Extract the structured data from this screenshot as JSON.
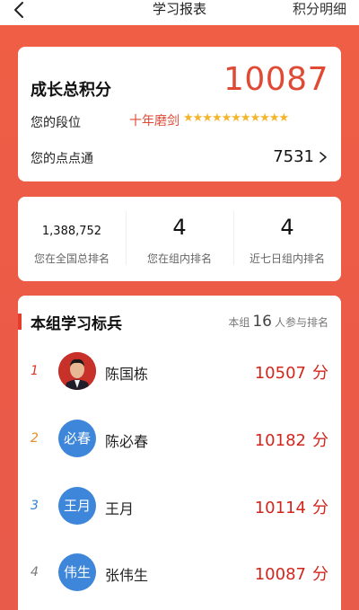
{
  "header": {
    "title": "学习报表",
    "right_link": "积分明细"
  },
  "summary": {
    "growth_label": "成长总积分",
    "growth_value": "10087",
    "rank_label": "您的段位",
    "rank_title": "十年磨剑",
    "rank_stars": "★★★★★★★★★★★",
    "points_label": "您的点点通",
    "points_value": "7531"
  },
  "stats": [
    {
      "value": "1,388,752",
      "label": "您在全国总排名"
    },
    {
      "value": "4",
      "label": "您在组内排名"
    },
    {
      "value": "4",
      "label": "近七日组内排名"
    }
  ],
  "group": {
    "title": "本组学习标兵",
    "meta_prefix": "本组",
    "meta_count": "16",
    "meta_suffix": "人参与排名",
    "unit": "分",
    "members": [
      {
        "rank": "1",
        "avatar_text": "",
        "name": "陈国栋",
        "score": "10507"
      },
      {
        "rank": "2",
        "avatar_text": "必春",
        "name": "陈必春",
        "score": "10182"
      },
      {
        "rank": "3",
        "avatar_text": "王月",
        "name": "王月",
        "score": "10114"
      },
      {
        "rank": "4",
        "avatar_text": "伟生",
        "name": "张伟生",
        "score": "10087"
      }
    ]
  },
  "colors": {
    "accent_red": "#e04a35",
    "background": "#ea5a47",
    "avatar_blue": "#3d86d9",
    "star_gold": "#f2b52b"
  },
  "icons": {
    "back": "chevron-left-icon",
    "points_arrow": "chevron-right-icon",
    "stars": "star-icon"
  }
}
